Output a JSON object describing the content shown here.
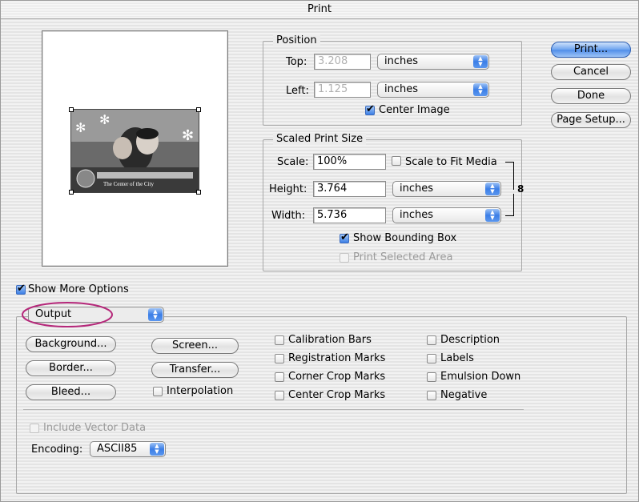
{
  "window": {
    "title": "Print"
  },
  "position": {
    "legend": "Position",
    "top_label": "Top:",
    "top_value": "3.208",
    "top_unit": "inches",
    "left_label": "Left:",
    "left_value": "1.125",
    "left_unit": "inches",
    "center_image": "Center Image",
    "center_image_checked": true
  },
  "scaled": {
    "legend": "Scaled Print Size",
    "scale_label": "Scale:",
    "scale_value": "100%",
    "scale_to_fit": "Scale to Fit Media",
    "height_label": "Height:",
    "height_value": "3.764",
    "height_unit": "inches",
    "width_label": "Width:",
    "width_value": "5.736",
    "width_unit": "inches",
    "show_bounding_box": "Show Bounding Box",
    "print_selected_area": "Print Selected Area"
  },
  "buttons": {
    "print": "Print...",
    "cancel": "Cancel",
    "done": "Done",
    "page_setup": "Page Setup..."
  },
  "preview": {
    "photo_caption": "The Center of the City"
  },
  "options": {
    "show_more": "Show More Options",
    "mode": "Output",
    "background": "Background...",
    "border": "Border...",
    "bleed": "Bleed...",
    "screen": "Screen...",
    "transfer": "Transfer...",
    "interpolation": "Interpolation",
    "calibration_bars": "Calibration Bars",
    "registration_marks": "Registration Marks",
    "corner_crop_marks": "Corner Crop Marks",
    "center_crop_marks": "Center Crop Marks",
    "description": "Description",
    "labels": "Labels",
    "emulsion_down": "Emulsion Down",
    "negative": "Negative",
    "include_vector": "Include Vector Data",
    "encoding_label": "Encoding:",
    "encoding_value": "ASCII85"
  },
  "colors": {
    "highlight_ellipse": "#b5287a",
    "default_button": "#5b97ee"
  }
}
